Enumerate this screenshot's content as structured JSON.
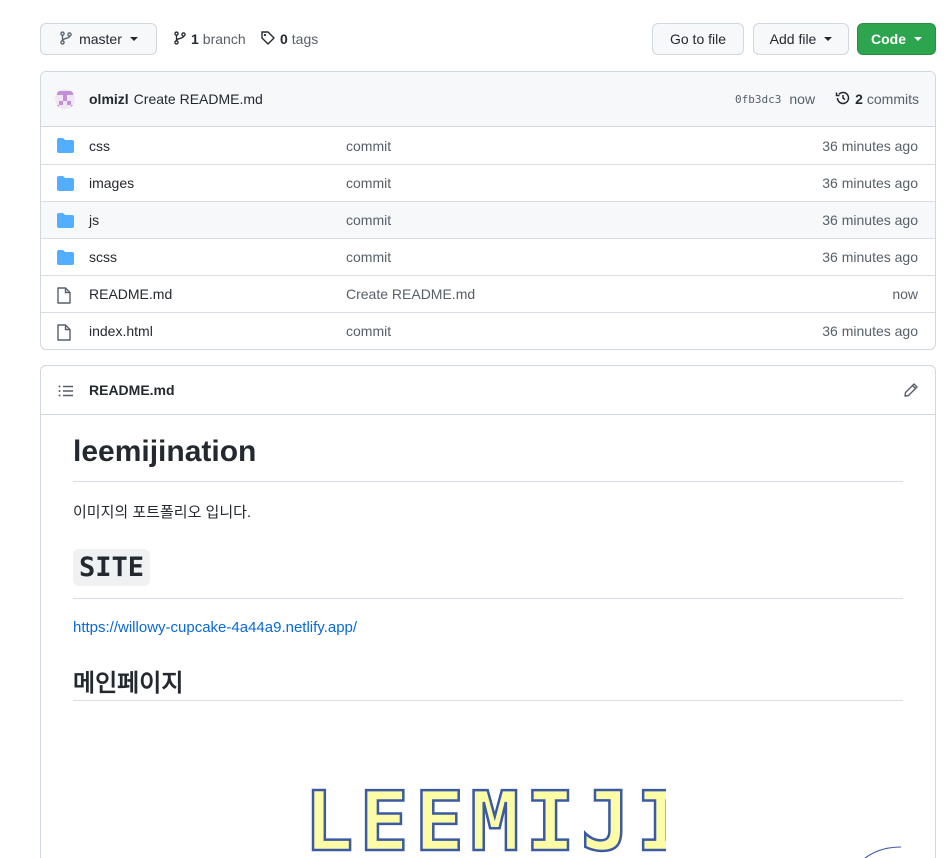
{
  "branch_selector": {
    "label": "master"
  },
  "branches": {
    "count": "1",
    "label": "branch"
  },
  "tags": {
    "count": "0",
    "label": "tags"
  },
  "actions": {
    "go_to_file": "Go to file",
    "add_file": "Add file",
    "code": "Code"
  },
  "latest_commit": {
    "author": "olmizl",
    "message": "Create README.md",
    "sha": "0fb3dc3",
    "time": "now",
    "commits_count": "2",
    "commits_label": "commits"
  },
  "files": [
    {
      "type": "folder",
      "name": "css",
      "message": "commit",
      "time": "36 minutes ago"
    },
    {
      "type": "folder",
      "name": "images",
      "message": "commit",
      "time": "36 minutes ago"
    },
    {
      "type": "folder",
      "name": "js",
      "message": "commit",
      "time": "36 minutes ago"
    },
    {
      "type": "folder",
      "name": "scss",
      "message": "commit",
      "time": "36 minutes ago"
    },
    {
      "type": "file",
      "name": "README.md",
      "message": "Create README.md",
      "time": "now"
    },
    {
      "type": "file",
      "name": "index.html",
      "message": "commit",
      "time": "36 minutes ago"
    }
  ],
  "readme": {
    "filename": "README.md",
    "title": "leemijination",
    "description": "이미지의 포트폴리오 입니다.",
    "site_heading": "SITE",
    "site_link": "https://willowy-cupcake-4a44a9.netlify.app/",
    "main_heading": "메인페이지",
    "logo_text": "LEEMIJI"
  },
  "colors": {
    "primary_green": "#2da44e",
    "link_blue": "#0969da",
    "folder_blue": "#54aeff",
    "logo_fill": "#fdfca6",
    "logo_stroke": "#3b5aa3"
  }
}
